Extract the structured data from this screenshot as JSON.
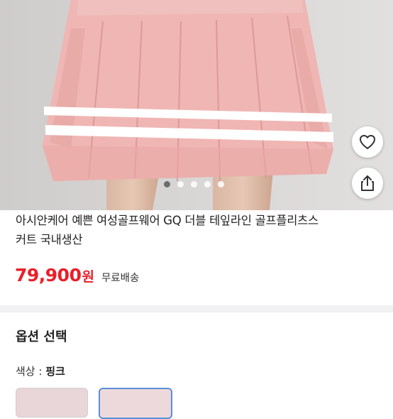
{
  "product": {
    "title_line1": "아시안케어 예쁜 여성골프웨어 GQ 더블 테잎라인 골프플리츠스",
    "title_line2": "커트 국내생산",
    "price": "79,900",
    "currency": "원",
    "shipping": "무료배송"
  },
  "gallery": {
    "dots": 5,
    "active_index": 0
  },
  "actions": {
    "like_icon": "heart-icon",
    "share_icon": "share-icon"
  },
  "options": {
    "header": "옵션 선택",
    "color_label": "색상",
    "color_sep": ":",
    "color_value": "핑크"
  },
  "colors": {
    "price": "#e8202a",
    "skirt": "#f0b6b3",
    "selected_border": "#5a8fd8"
  }
}
